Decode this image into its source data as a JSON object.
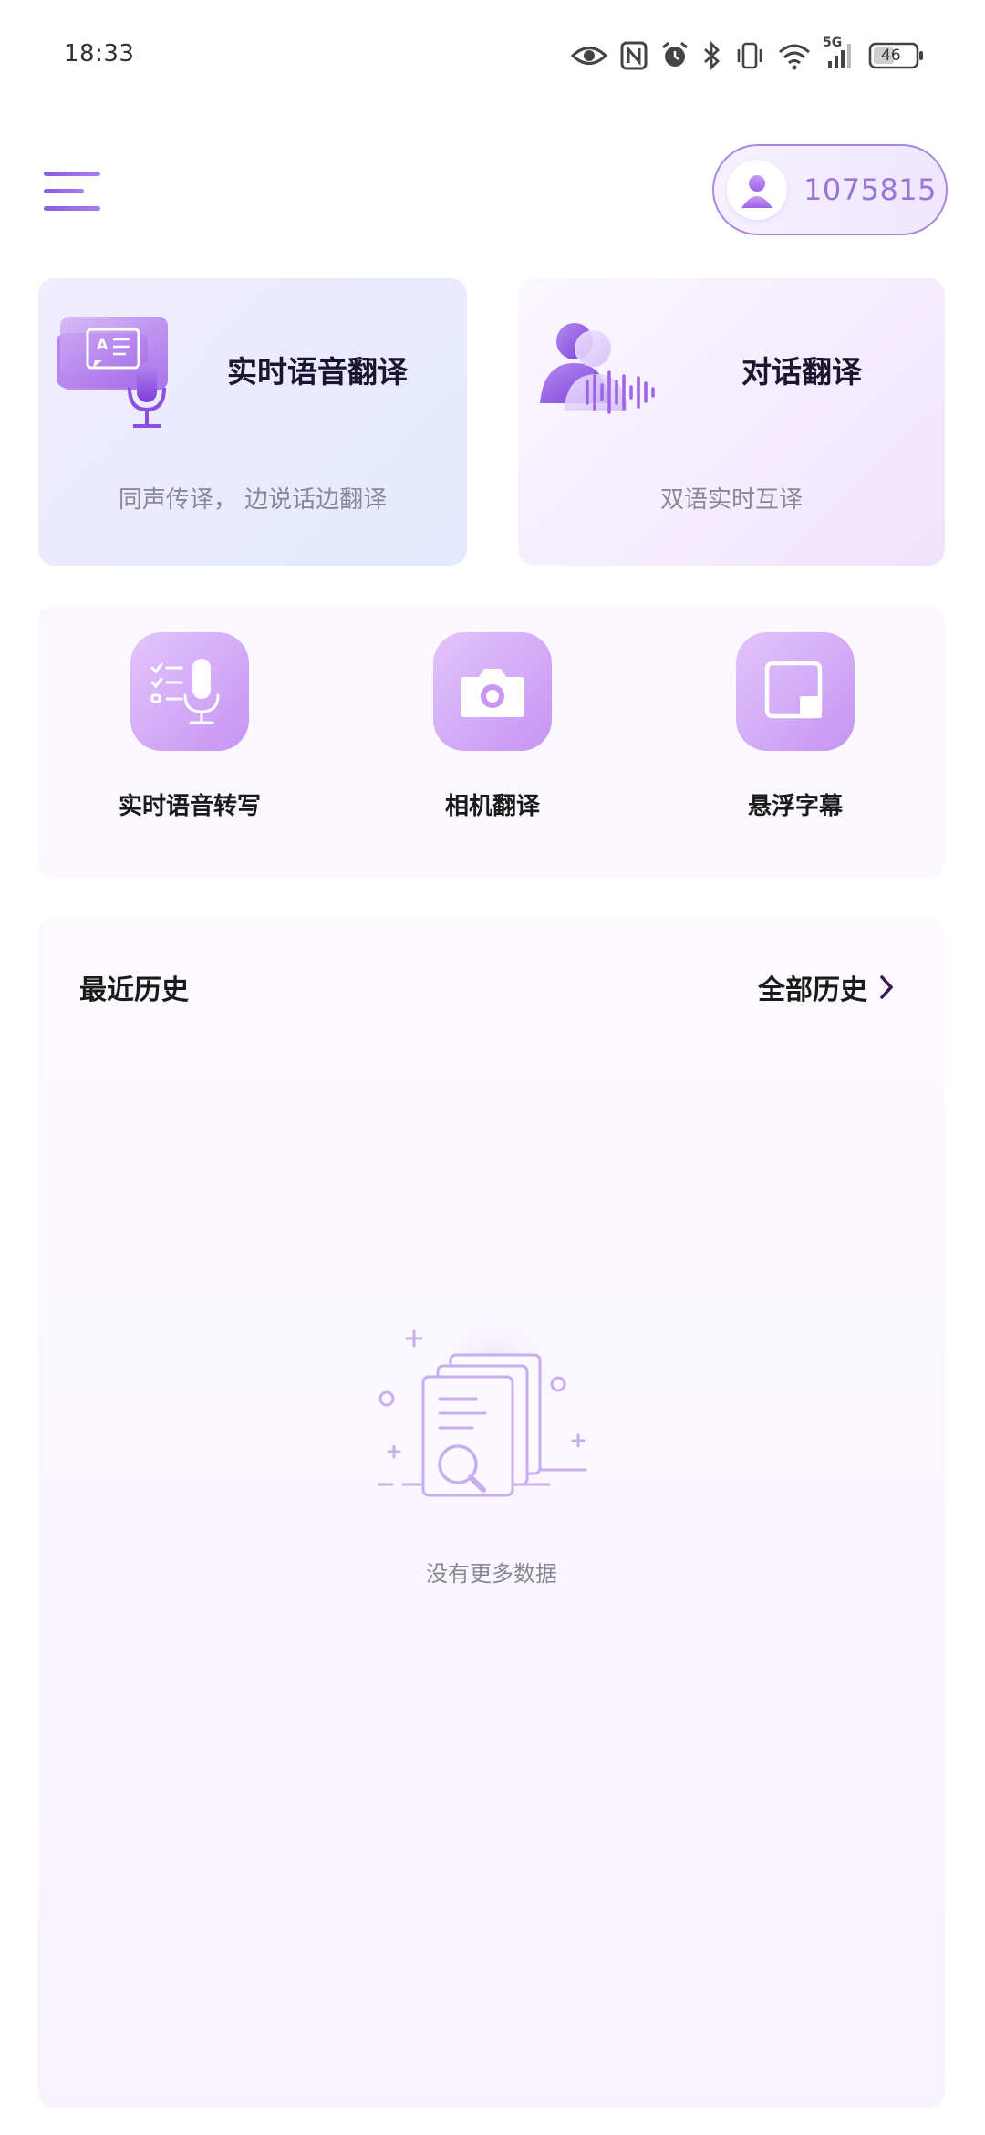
{
  "status_bar": {
    "time": "18:33",
    "network": "5G",
    "battery": "46",
    "icons": [
      "eye-icon",
      "nfc-icon",
      "alarm-icon",
      "bluetooth-icon",
      "vibrate-icon",
      "wifi-icon",
      "signal-icon",
      "battery-icon"
    ]
  },
  "header": {
    "menu_icon": "menu-icon",
    "user_id": "1075815"
  },
  "feature_cards": [
    {
      "title": "实时语音翻译",
      "subtitle": "同声传译， 边说话边翻译",
      "icon": "speech-translate-icon"
    },
    {
      "title": "对话翻译",
      "subtitle": "双语实时互译",
      "icon": "conversation-icon"
    }
  ],
  "tools": [
    {
      "label": "实时语音转写",
      "icon": "transcribe-icon"
    },
    {
      "label": "相机翻译",
      "icon": "camera-icon"
    },
    {
      "label": "悬浮字幕",
      "icon": "floating-caption-icon"
    }
  ],
  "history": {
    "title": "最近历史",
    "all_label": "全部历史",
    "empty_text": "没有更多数据"
  },
  "colors": {
    "accent": "#9a6ee0",
    "accent_light": "#e2c5fb",
    "text_primary": "#1a1a1a",
    "text_secondary": "#8a8793"
  }
}
